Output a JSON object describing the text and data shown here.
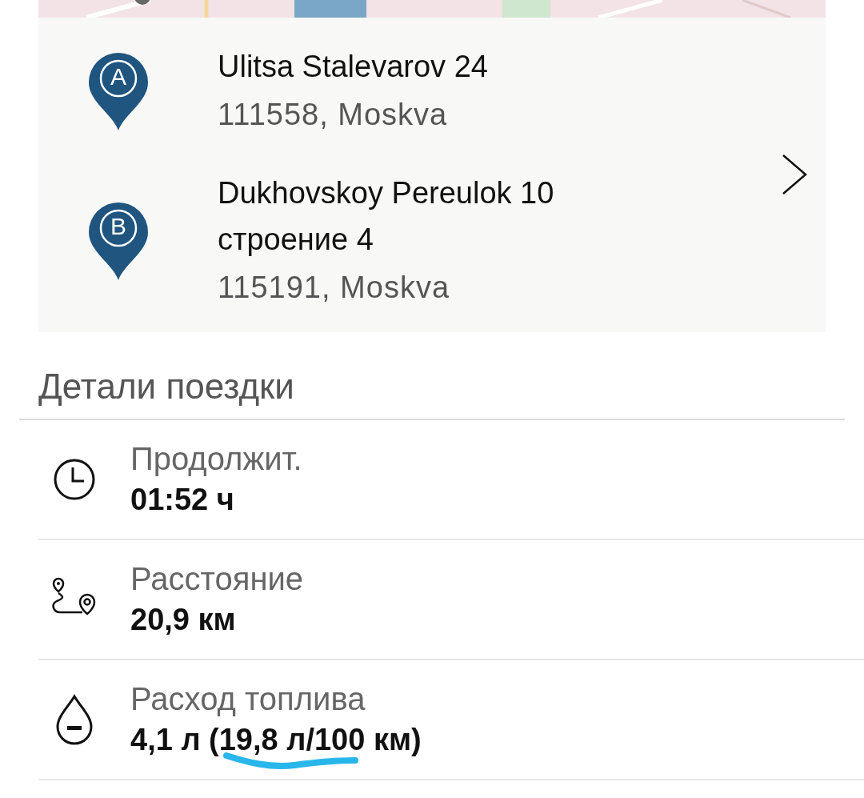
{
  "route": {
    "stops": [
      {
        "pin": "A",
        "lines": [
          "Ulitsa Stalevarov 24"
        ],
        "postal": "111558, Moskva"
      },
      {
        "pin": "B",
        "lines": [
          "Dukhovskoy Pereulok 10",
          "строение 4"
        ],
        "postal": "115191, Moskva"
      }
    ]
  },
  "trip_details": {
    "title": "Детали поездки",
    "items": [
      {
        "kind": "duration",
        "label": "Продолжит.",
        "value": "01:52 ч",
        "annotated": false
      },
      {
        "kind": "distance",
        "label": "Расстояние",
        "value": "20,9 км",
        "annotated": false
      },
      {
        "kind": "fuel",
        "label": "Расход топлива",
        "value": "4,1 л (19,8 л/100 км)",
        "annotated": true
      }
    ]
  }
}
